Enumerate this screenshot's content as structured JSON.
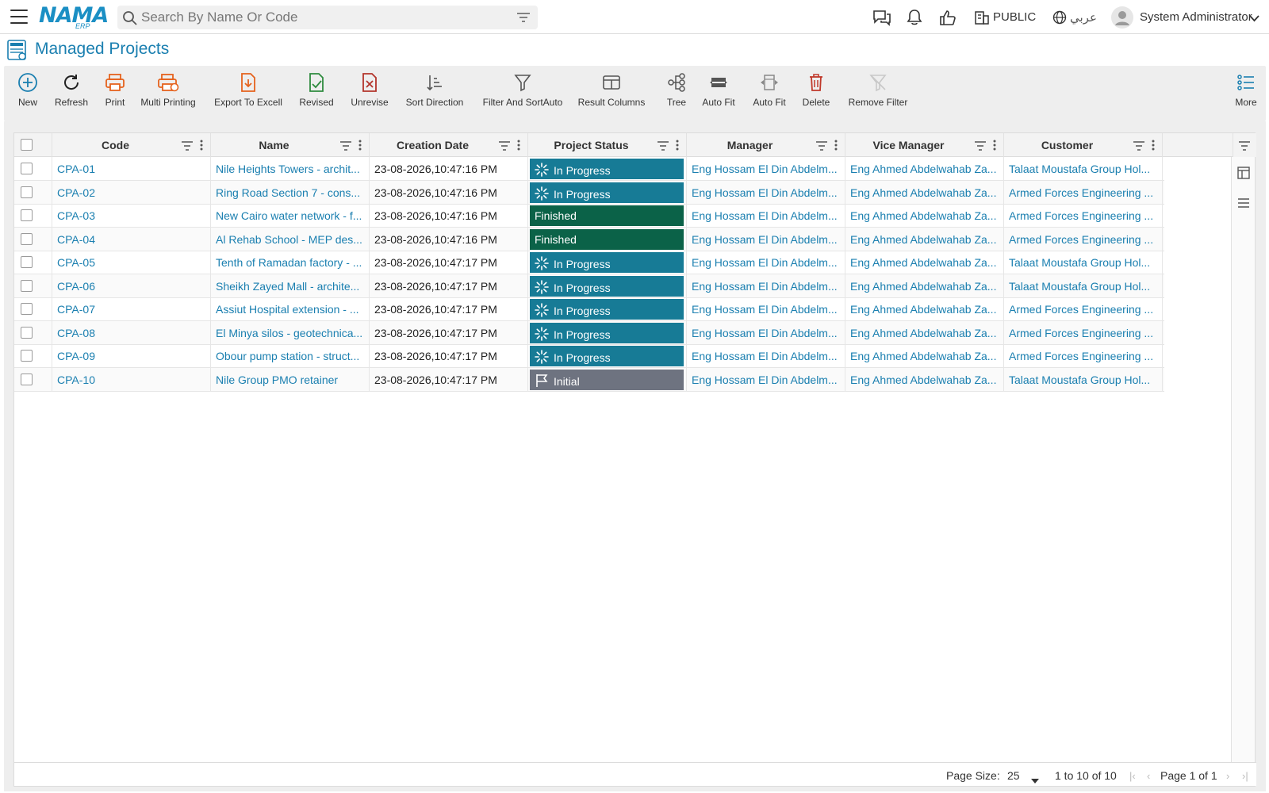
{
  "topbar": {
    "logo_main": "NAMA",
    "logo_sub": "ERP",
    "search_placeholder": "Search By Name Or Code",
    "branch": "PUBLIC",
    "language": "عربي",
    "user": "System Administrator"
  },
  "page": {
    "title": "Managed Projects"
  },
  "toolbar": {
    "new": "New",
    "refresh": "Refresh",
    "print": "Print",
    "multi_printing": "Multi Printing",
    "export": "Export To Excell",
    "revised": "Revised",
    "unrevise": "Unrevise",
    "sort_direction": "Sort Direction",
    "filter_sort": "Filter And SortAuto",
    "result_columns": "Result Columns",
    "tree": "Tree",
    "auto_fit_1": "Auto Fit",
    "auto_fit_2": "Auto Fit",
    "delete": "Delete",
    "remove_filter": "Remove Filter",
    "more": "More"
  },
  "grid": {
    "columns": [
      "Code",
      "Name",
      "Creation Date",
      "Project Status",
      "Manager",
      "Vice Manager",
      "Customer"
    ],
    "rows": [
      {
        "code": "CPA-01",
        "name": "Nile Heights Towers - archit...",
        "date": "23-08-2026,10:47:16 PM",
        "status": "In Progress",
        "manager": "Eng Hossam El Din Abdelm...",
        "vice": "Eng Ahmed Abdelwahab Za...",
        "customer": "Talaat Moustafa Group Hol..."
      },
      {
        "code": "CPA-02",
        "name": "Ring Road Section 7 - cons...",
        "date": "23-08-2026,10:47:16 PM",
        "status": "In Progress",
        "manager": "Eng Hossam El Din Abdelm...",
        "vice": "Eng Ahmed Abdelwahab Za...",
        "customer": "Armed Forces Engineering ..."
      },
      {
        "code": "CPA-03",
        "name": "New Cairo water network - f...",
        "date": "23-08-2026,10:47:16 PM",
        "status": "Finished",
        "manager": "Eng Hossam El Din Abdelm...",
        "vice": "Eng Ahmed Abdelwahab Za...",
        "customer": "Armed Forces Engineering ..."
      },
      {
        "code": "CPA-04",
        "name": "Al Rehab School - MEP des...",
        "date": "23-08-2026,10:47:16 PM",
        "status": "Finished",
        "manager": "Eng Hossam El Din Abdelm...",
        "vice": "Eng Ahmed Abdelwahab Za...",
        "customer": "Armed Forces Engineering ..."
      },
      {
        "code": "CPA-05",
        "name": "Tenth of Ramadan factory - ...",
        "date": "23-08-2026,10:47:17 PM",
        "status": "In Progress",
        "manager": "Eng Hossam El Din Abdelm...",
        "vice": "Eng Ahmed Abdelwahab Za...",
        "customer": "Talaat Moustafa Group Hol..."
      },
      {
        "code": "CPA-06",
        "name": "Sheikh Zayed Mall - archite...",
        "date": "23-08-2026,10:47:17 PM",
        "status": "In Progress",
        "manager": "Eng Hossam El Din Abdelm...",
        "vice": "Eng Ahmed Abdelwahab Za...",
        "customer": "Talaat Moustafa Group Hol..."
      },
      {
        "code": "CPA-07",
        "name": "Assiut Hospital extension - ...",
        "date": "23-08-2026,10:47:17 PM",
        "status": "In Progress",
        "manager": "Eng Hossam El Din Abdelm...",
        "vice": "Eng Ahmed Abdelwahab Za...",
        "customer": "Armed Forces Engineering ..."
      },
      {
        "code": "CPA-08",
        "name": "El Minya silos - geotechnica...",
        "date": "23-08-2026,10:47:17 PM",
        "status": "In Progress",
        "manager": "Eng Hossam El Din Abdelm...",
        "vice": "Eng Ahmed Abdelwahab Za...",
        "customer": "Armed Forces Engineering ..."
      },
      {
        "code": "CPA-09",
        "name": "Obour pump station - struct...",
        "date": "23-08-2026,10:47:17 PM",
        "status": "In Progress",
        "manager": "Eng Hossam El Din Abdelm...",
        "vice": "Eng Ahmed Abdelwahab Za...",
        "customer": "Armed Forces Engineering ..."
      },
      {
        "code": "CPA-10",
        "name": "Nile Group PMO retainer",
        "date": "23-08-2026,10:47:17 PM",
        "status": "Initial",
        "manager": "Eng Hossam El Din Abdelm...",
        "vice": "Eng Ahmed Abdelwahab Za...",
        "customer": "Talaat Moustafa Group Hol..."
      }
    ]
  },
  "status_colors": {
    "In Progress": "#177b96",
    "Finished": "#0b6248",
    "Initial": "#6e7380"
  },
  "footer": {
    "page_size_label": "Page Size:",
    "page_size": "25",
    "range": "1 to 10 of 10",
    "page": "Page 1 of 1"
  }
}
